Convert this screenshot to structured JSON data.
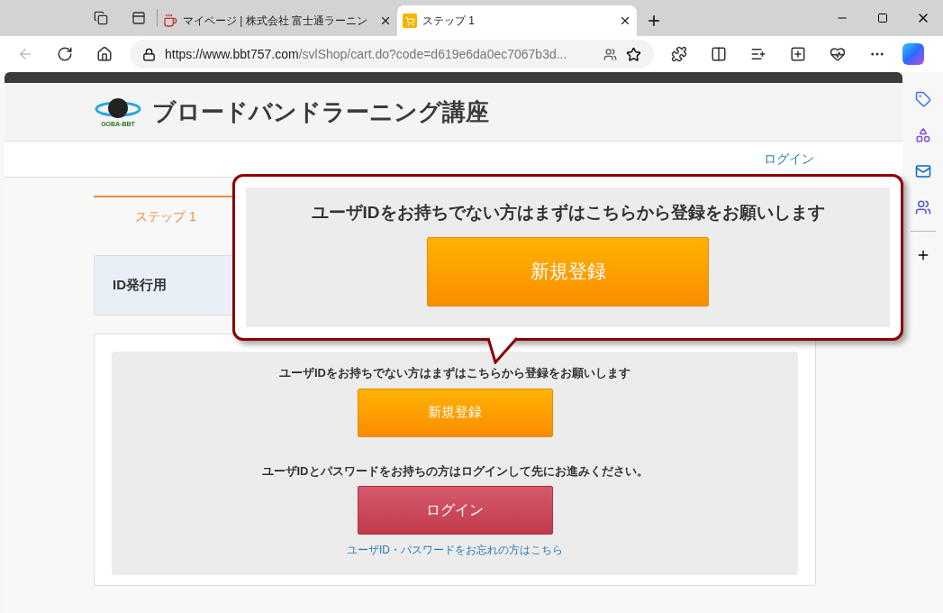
{
  "browser": {
    "tabs": [
      {
        "title": "マイページ | 株式会社 富士通ラーニン",
        "selected": false,
        "kind": "cup"
      },
      {
        "title": "ステップ 1",
        "selected": true,
        "kind": "cart"
      }
    ],
    "url_host": "https://www.bbt757.com",
    "url_path": "/svlShop/cart.do?code=d619e6da0ec7067b3d..."
  },
  "site": {
    "logo_text": "GOBA-BBT",
    "title": "ブロードバンドラーニング講座",
    "nav_link": "ログイン",
    "steps": [
      {
        "label": "ステップ 1",
        "selected": true
      }
    ],
    "id_card": "ID発行用",
    "register_prompt": "ユーザIDをお持ちでない方はまずはこちらから登録をお願いします",
    "register_button": "新規登録",
    "login_prompt": "ユーザIDとパスワードをお持ちの方はログインして先にお進みください。",
    "login_button": "ログイン",
    "forgot_link": "ユーザID・パスワードをお忘れの方はこちら"
  },
  "callout": {
    "prompt": "ユーザIDをお持ちでない方はまずはこちらから登録をお願いします",
    "button": "新規登録"
  }
}
